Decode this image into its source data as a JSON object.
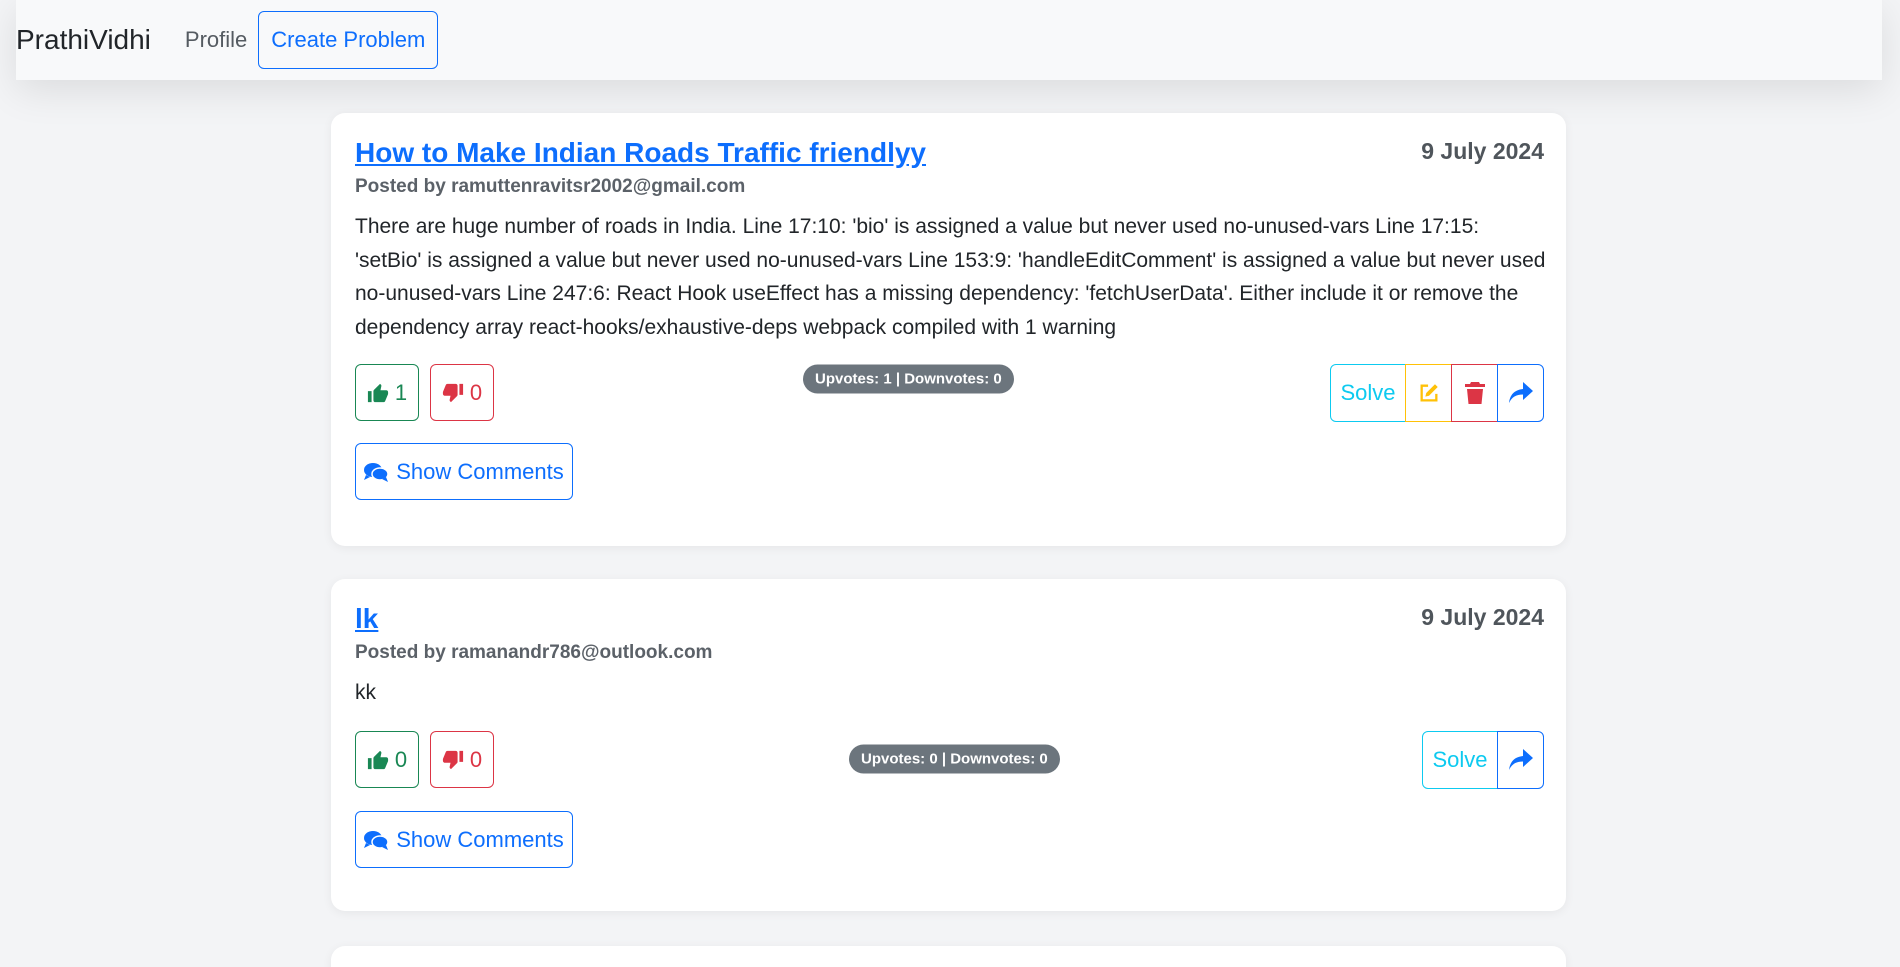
{
  "navbar": {
    "brand": "PrathiVidhi",
    "profile_label": "Profile",
    "create_label": "Create Problem"
  },
  "posts": [
    {
      "title": "How to Make Indian Roads Traffic friendlyy",
      "date": "9 July 2024",
      "posted_by": "Posted by ramuttenravitsr2002@gmail.com",
      "description": "There are huge number of roads in India. Line 17:10: 'bio' is assigned a value but never used no-unused-vars Line 17:15: 'setBio' is assigned a value but never used no-unused-vars Line 153:9: 'handleEditComment' is assigned a value but never used no-unused-vars Line 247:6: React Hook useEffect has a missing dependency: 'fetchUserData'. Either include it or remove the dependency array react-hooks/exhaustive-deps webpack compiled with 1 warning",
      "upvotes": "1",
      "downvotes": "0",
      "vote_summary": "Upvotes: 1 | Downvotes: 0",
      "solve_label": "Solve",
      "comments_label": "Show Comments"
    },
    {
      "title": "lk",
      "date": "9 July 2024",
      "posted_by": "Posted by ramanandr786@outlook.com",
      "description": "kk",
      "upvotes": "0",
      "downvotes": "0",
      "vote_summary": "Upvotes: 0 | Downvotes: 0",
      "solve_label": "Solve",
      "comments_label": "Show Comments"
    }
  ],
  "colors": {
    "primary": "#0d6efd",
    "success": "#198754",
    "danger": "#dc3545",
    "warning": "#ffc107",
    "info": "#0dcaf0",
    "badge": "#6c757d"
  },
  "icons": [
    "thumbs-up-icon",
    "thumbs-down-icon",
    "edit-icon",
    "trash-icon",
    "share-icon",
    "comments-icon"
  ]
}
